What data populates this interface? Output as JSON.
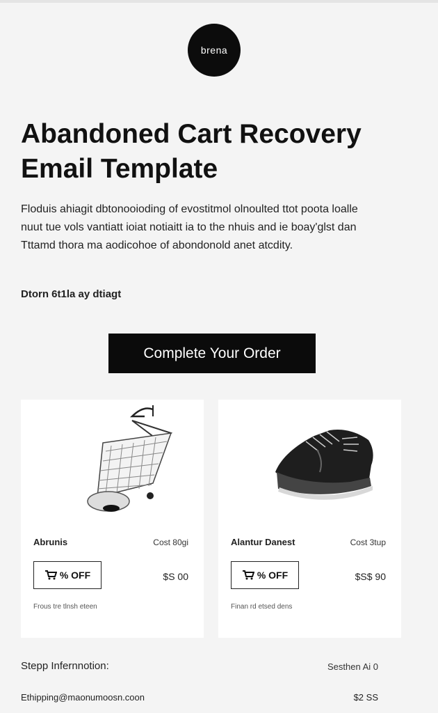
{
  "brand": {
    "logo_text": "brena"
  },
  "headline": "Abandoned Cart Recovery Email Template",
  "intro_text": "Floduis ahiagit dbtonooioding of evostitmol olnoulted ttot poota loalle nuut tue vols vantiatt ioiat notiaitt ia to the nhuis and ie boay'glst dan Tttamd thora ma aodicohoe of abondonold anet atcdity.",
  "note_text": "Dtorn 6t1la ay dtiagt",
  "cta_label": "Complete Your Order",
  "products": [
    {
      "name": "Abrunis",
      "cost_label": "Cost 80gi",
      "coupon_label": "% OFF",
      "price": "$S 00",
      "meta": "Frous tre tlnsh eteen",
      "image_icon": "baby-bassinet-icon"
    },
    {
      "name": "Alantur Danest",
      "cost_label": "Cost 3tup",
      "coupon_label": "% OFF",
      "price": "$S$ 90",
      "meta": "Finan rd etsed dens",
      "image_icon": "sneaker-icon"
    }
  ],
  "shipping": {
    "heading": "Stepp Infernnotion:",
    "right_label": "Sesthen Ai 0",
    "email": "Ethipping@maonumoosn.coon",
    "amount": "$2 SS"
  },
  "colors": {
    "background": "#f4f4f4",
    "accent": "#0b0b0b",
    "card": "#ffffff"
  }
}
